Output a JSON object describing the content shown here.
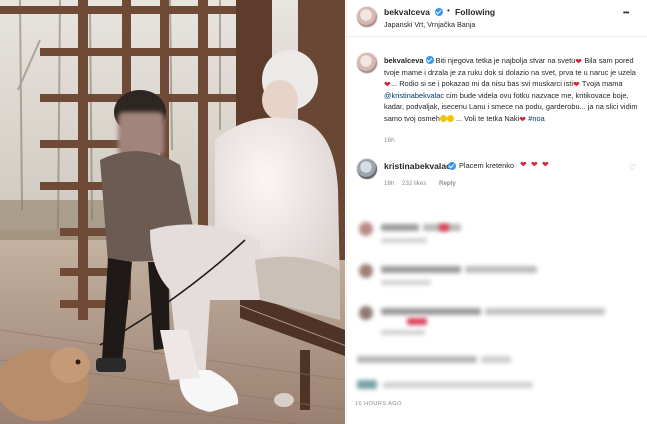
{
  "header": {
    "username": "bekvalceva",
    "separator": "•",
    "follow_label": "Following",
    "location": "Japanski Vrt, Vrnjačka Banja",
    "more_label": "•••"
  },
  "caption": {
    "username": "bekvalceva",
    "part1": "Biti njegova tetka je najbolja stvar na svetu",
    "part2": "Bila sam pored tvoje mame i drzala je za ruku dok si dolazio na svet, prva te u naruc je uzela",
    "part3": "... Rodio si se i pokazao mi da nisu bas svi muskarci isti",
    "part4": "Tvoja mama",
    "mention": "@kristinabekvalac",
    "part5": "cim bude videla ovu fotku nazvace me, kritikovace boje, kadar, podvaljak, isecenu Lanu i smece na podu, garderobu... ja na slici vidim samo tvoj osmeh",
    "part6": "... Voli te tetka Naki",
    "hashtag": "#noa",
    "time": "16h"
  },
  "first_comment": {
    "username": "kristinabekvalac",
    "text": "Placem kretenko",
    "time": "16h",
    "likes": "232 likes",
    "reply": "Reply"
  },
  "footer": {
    "date": "16 HOURS AGO"
  },
  "colors": {
    "verified": "#3897f0",
    "heart": "#d9263a",
    "mention": "#00376b",
    "secondary_text": "#8e8e8e"
  },
  "icons": {
    "verified": "verified-badge-icon",
    "heart": "red-heart-emoji",
    "like": "heart-outline-icon",
    "more": "more-options-icon"
  }
}
